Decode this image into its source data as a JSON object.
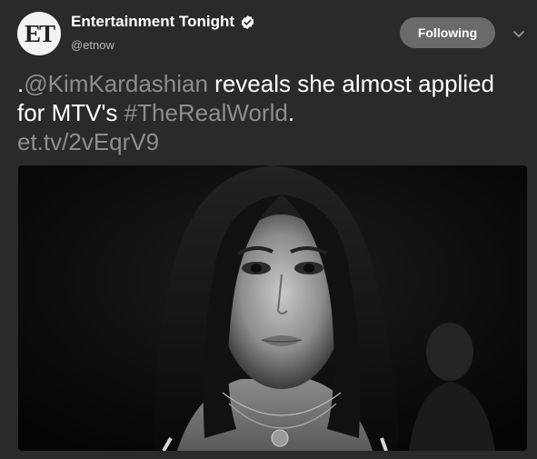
{
  "account": {
    "avatar_text": "ET",
    "display_name": "Entertainment Tonight",
    "handle": "@etnow",
    "verified": true
  },
  "follow_button": {
    "label": "Following"
  },
  "menu": {
    "icon": "chevron-down-icon"
  },
  "tweet": {
    "lead": ".",
    "mention": "@KimKardashian",
    "text_part1": " reveals she almost applied for MTV's ",
    "hashtag": "#TheRealWorld",
    "text_part2": ".",
    "link": "et.tv/2vEqrV9"
  },
  "media": {
    "description_icon": "photo",
    "style": "black-and-white portrait photo"
  },
  "colors": {
    "background": "#2a2a2a",
    "text": "#ffffff",
    "dim_text": "#8e8e8e",
    "button_bg": "#6a6a6a"
  }
}
